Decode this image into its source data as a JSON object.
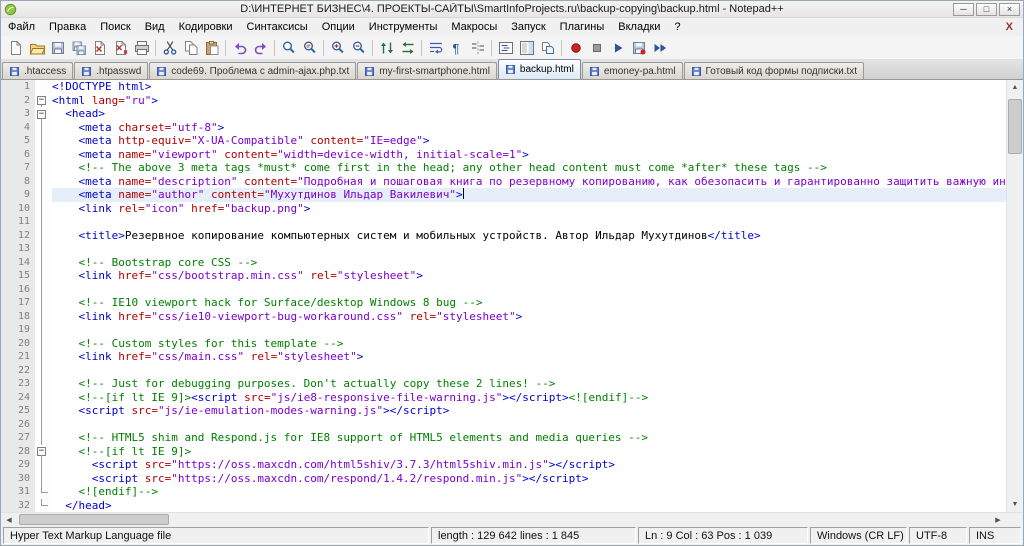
{
  "window": {
    "title": "D:\\ИНТЕРНЕТ БИЗНЕС\\4. ПРОЕКТЫ-САЙТЫ\\SmartInfoProjects.ru\\backup-copying\\backup.html - Notepad++",
    "minimize_icon": "─",
    "restore_icon": "□",
    "close_icon": "×"
  },
  "menu": {
    "items": [
      "Файл",
      "Правка",
      "Поиск",
      "Вид",
      "Кодировки",
      "Синтаксисы",
      "Опции",
      "Инструменты",
      "Макросы",
      "Запуск",
      "Плагины",
      "Вкладки",
      "?"
    ],
    "close_button": "X"
  },
  "toolbar": {
    "items": [
      "new-file",
      "open-file",
      "save",
      "save-all",
      "close",
      "close-all",
      "print",
      "separator",
      "cut",
      "copy",
      "paste",
      "separator",
      "undo",
      "redo",
      "separator",
      "find",
      "replace",
      "separator",
      "zoom-in",
      "zoom-out",
      "separator",
      "sync-vertical-scrolling",
      "sync-horizontal-scrolling",
      "separator",
      "word-wrap",
      "show-all-characters",
      "show-indent-guide",
      "separator",
      "function-list",
      "document-map",
      "document-switcher",
      "separator",
      "record-macro",
      "stop-recording",
      "playback-macro",
      "save-macro",
      "run-macro-multiple"
    ]
  },
  "tabs": [
    {
      "label": ".htaccess",
      "active": false
    },
    {
      "label": ".htpasswd",
      "active": false
    },
    {
      "label": "code69. Проблема с admin-ajax.php.txt",
      "active": false
    },
    {
      "label": "my-first-smartphone.html",
      "active": false
    },
    {
      "label": "backup.html",
      "active": true
    },
    {
      "label": "emoney-pa.html",
      "active": false
    },
    {
      "label": "Готовый код формы подписки.txt",
      "active": false
    }
  ],
  "editor": {
    "caret_line": 9,
    "lines": [
      "<!DOCTYPE html>",
      "<html lang=\"ru\">",
      "  <head>",
      "    <meta charset=\"utf-8\">",
      "    <meta http-equiv=\"X-UA-Compatible\" content=\"IE=edge\">",
      "    <meta name=\"viewport\" content=\"width=device-width, initial-scale=1\">",
      "    <!-- The above 3 meta tags *must* come first in the head; any other head content must come *after* these tags -->",
      "    <meta name=\"description\" content=\"Подробная и пошаговая книга по резервному копированию, как обезопасить и гарантированно защитить важную информацию от внез",
      "    <meta name=\"author\" content=\"Мухутдинов Ильдар Вакилевич\">",
      "    <link rel=\"icon\" href=\"backup.png\">",
      "",
      "    <title>Резервное копирование компьютерных систем и мобильных устройств. Автор Ильдар Мухутдинов</title>",
      "",
      "    <!-- Bootstrap core CSS -->",
      "    <link href=\"css/bootstrap.min.css\" rel=\"stylesheet\">",
      "",
      "    <!-- IE10 viewport hack for Surface/desktop Windows 8 bug -->",
      "    <link href=\"css/ie10-viewport-bug-workaround.css\" rel=\"stylesheet\">",
      "",
      "    <!-- Custom styles for this template -->",
      "    <link href=\"css/main.css\" rel=\"stylesheet\">",
      "",
      "    <!-- Just for debugging purposes. Don't actually copy these 2 lines! -->",
      "    <!--[if lt IE 9]><script src=\"js/ie8-responsive-file-warning.js\"></script><![endif]-->",
      "    <script src=\"js/ie-emulation-modes-warning.js\"></script>",
      "",
      "    <!-- HTML5 shim and Respond.js for IE8 support of HTML5 elements and media queries -->",
      "    <!--[if lt IE 9]>",
      "      <script src=\"https://oss.maxcdn.com/html5shiv/3.7.3/html5shiv.min.js\"></script>",
      "      <script src=\"https://oss.maxcdn.com/respond/1.4.2/respond.min.js\"></script>",
      "    <![endif]-->",
      "  </head>"
    ],
    "fold": [
      "none",
      "box",
      "box",
      "line",
      "line",
      "line",
      "line",
      "line",
      "line",
      "line",
      "line",
      "line",
      "line",
      "line",
      "line",
      "line",
      "line",
      "line",
      "line",
      "line",
      "line",
      "line",
      "line",
      "line",
      "line",
      "line",
      "line",
      "box",
      "line",
      "line",
      "end",
      "end"
    ]
  },
  "scrollbar": {
    "up_icon": "▲",
    "down_icon": "▼",
    "left_icon": "◀",
    "right_icon": "▶"
  },
  "status_bar": {
    "doc_type": "Hyper Text Markup Language file",
    "length_info": "length : 129 642  lines : 1 845",
    "cursor_info": "Ln : 9   Col : 63   Pos : 1 039",
    "eol": "Windows (CR LF)",
    "encoding": "UTF-8",
    "mode": "INS"
  },
  "colors": {
    "tag": "#0000cd",
    "attribute": "#b00000",
    "value": "#7a00cc",
    "comment": "#008000",
    "text": "#000000",
    "current_line": "#e6eefa"
  }
}
